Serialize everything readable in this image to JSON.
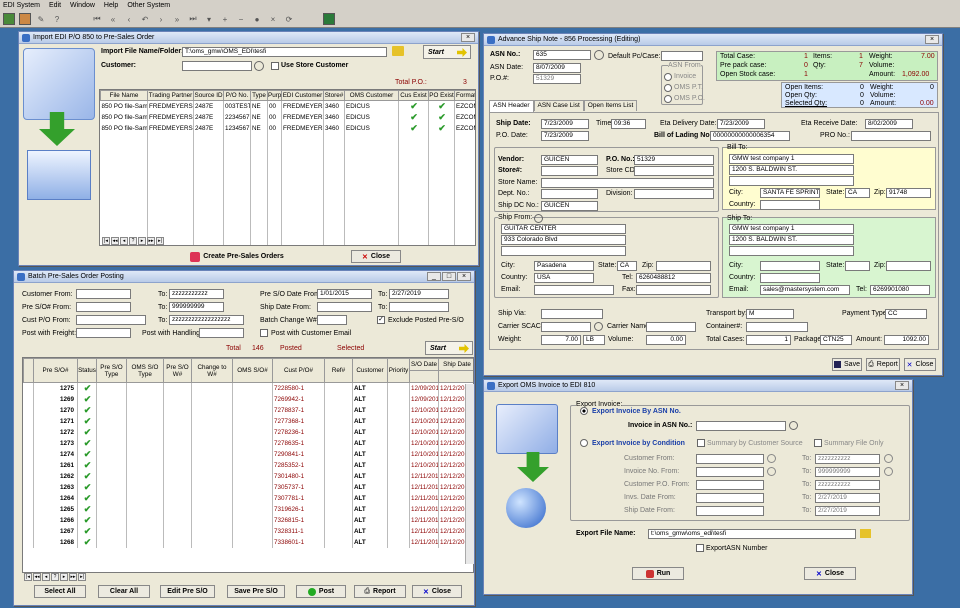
{
  "menu": [
    "EDI System",
    "Edit",
    "Window",
    "Help",
    "Other System"
  ],
  "import": {
    "title": "Import EDI P/O 850 to Pre-Sales Order",
    "folder_label": "Import File Name/Folder:",
    "folder_value": "T:\\oms_gmw\\OMS_EDI\\tesfi",
    "customer_label": "Customer:",
    "use_store": "Use Store Customer",
    "start": "Start",
    "total_label": "Total P.O.:",
    "total_value": "3",
    "columns": [
      "File Name",
      "Trading Partner",
      "Source ID",
      "P/O No.",
      "Type",
      "Purpo",
      "EDI Customer",
      "Store#",
      "OMS Customer",
      "Cus Exist",
      "PO Exist",
      "Format"
    ],
    "rows": [
      [
        "850 PO file-Samp",
        "FREDMEYERS",
        "2487E",
        "003TEST",
        "NE",
        "00",
        "FREDMEYERS",
        "3460",
        "EDICUS",
        "✔",
        "✔",
        "EZCOM"
      ],
      [
        "850 PO file-Samp",
        "FREDMEYERS",
        "2487E",
        "2234567",
        "NE",
        "00",
        "FREDMEYERS",
        "3460",
        "EDICUS",
        "✔",
        "✔",
        "EZCOM"
      ],
      [
        "850 PO file-Samp",
        "FREDMEYERS",
        "2487E",
        "1234567",
        "NE",
        "00",
        "FREDMEYERS",
        "3460",
        "EDICUS",
        "✔",
        "✔",
        "EZCOM"
      ]
    ],
    "create": "Create Pre-Sales Orders",
    "close": "Close"
  },
  "batch": {
    "title": "Batch Pre-Sales Order Posting",
    "customer_from": "Customer From:",
    "to": "To:",
    "customer_to": "zzzzzzzzzzz",
    "pre_so_from": "Pre S/O# From:",
    "pre_so_to": "999999999",
    "cust_po_from": "Cust P/O From:",
    "cust_po_to": "zzzzzzzzzzzzzzzzzz",
    "freight": "Post with Freight:",
    "handling": "Post with Handling:",
    "so_date_from": "Pre S/O Date From:",
    "so_date_from_val": "1/01/2015",
    "so_date_to_val": "2/27/2019",
    "ship_date_from": "Ship Date From:",
    "batch_change": "Batch Change W#:",
    "exclude": "Exclude Posted Pre-S/O",
    "post_email": "Post with Customer Email",
    "total": "Total",
    "total_val": "146",
    "posted": "Posted",
    "selected": "Selected",
    "start": "Start",
    "columns": [
      "Pre S/O#",
      "Status",
      "Pre S/O Type",
      "OMS S/O Type",
      "Pre S/O W#",
      "Change to W#",
      "OMS S/O#",
      "Cust P/O#",
      "Ref#",
      "Customer",
      "Priority",
      "S/O Date",
      "Ship Date"
    ],
    "rows": [
      [
        "1275",
        "7228580-1",
        "ALT",
        "12/09/2016",
        "12/12/2016"
      ],
      [
        "1269",
        "7269942-1",
        "ALT",
        "12/09/2016",
        "12/12/2016"
      ],
      [
        "1270",
        "7278837-1",
        "ALT",
        "12/10/2016",
        "12/12/2016"
      ],
      [
        "1271",
        "7277368-1",
        "ALT",
        "12/10/2016",
        "12/12/2016"
      ],
      [
        "1272",
        "7278236-1",
        "ALT",
        "12/10/2016",
        "12/12/2016"
      ],
      [
        "1273",
        "7278635-1",
        "ALT",
        "12/10/2016",
        "12/12/2016"
      ],
      [
        "1274",
        "7290841-1",
        "ALT",
        "12/10/2016",
        "12/12/2016"
      ],
      [
        "1261",
        "7285352-1",
        "ALT",
        "12/10/2016",
        "12/12/2016"
      ],
      [
        "1262",
        "7301480-1",
        "ALT",
        "12/11/2016",
        "12/12/2016"
      ],
      [
        "1263",
        "7305737-1",
        "ALT",
        "12/11/2016",
        "12/12/2016"
      ],
      [
        "1264",
        "7307781-1",
        "ALT",
        "12/11/2016",
        "12/12/2016"
      ],
      [
        "1265",
        "7319626-1",
        "ALT",
        "12/11/2016",
        "12/12/2016"
      ],
      [
        "1266",
        "7326815-1",
        "ALT",
        "12/11/2016",
        "12/12/2016"
      ],
      [
        "1267",
        "7328311-1",
        "ALT",
        "12/11/2016",
        "12/12/2016"
      ],
      [
        "1268",
        "7338601-1",
        "ALT",
        "12/11/2016",
        "12/12/2016"
      ]
    ],
    "select_all": "Select All",
    "clear_all": "Clear All",
    "edit": "Edit Pre S/O",
    "save": "Save Pre S/O",
    "post": "Post",
    "report": "Report",
    "close": "Close"
  },
  "asn": {
    "title": "Advance Ship Note - 856 Processing (Editing)",
    "asn_no_l": "ASN No.:",
    "asn_no": "635",
    "asn_date_l": "ASN Date:",
    "asn_date": "8/07/2009",
    "po_l": "P.O.#:",
    "po": "51329",
    "default_pc": "Default Pc/Case:",
    "asn_from": "ASN From",
    "opt1": "Invoice",
    "opt2": "OMS P.T.",
    "opt3": "OMS P.O.",
    "sum": {
      "tc_l": "Total Case:",
      "tc": "1",
      "items_l": "Items:",
      "items": "1",
      "weight_l": "Weight:",
      "weight": "7.00",
      "ppc_l": "Pre pack case:",
      "ppc": "0",
      "qty_l": "Qty:",
      "qty": "7",
      "volume_l": "Volume:",
      "osc_l": "Open Stock case:",
      "osc": "1",
      "amount_l": "Amount:",
      "amount": "1,092.00",
      "oi_l": "Open Items:",
      "oi": "0",
      "w2_l": "Weight:",
      "w2": "0",
      "oq_l": "Open Qty:",
      "oq": "0",
      "v2_l": "Volume:",
      "sq_l": "Selected Qty:",
      "sq": "0",
      "a2_l": "Amount:",
      "a2": "0.00"
    },
    "tabs": [
      "ASN Header",
      "ASN Case List",
      "Open Items List"
    ],
    "ship_date_l": "Ship Date:",
    "ship_date": "7/23/2009",
    "time_l": "Time:",
    "time": "09:36",
    "eta_del_l": "Eta Delivery Date:",
    "eta_del": "7/23/2009",
    "eta_rec_l": "Eta Receive Date:",
    "eta_rec": "8/02/2009",
    "po_date_l": "P.O. Date:",
    "po_date": "7/23/2009",
    "bol_l": "Bill of Lading No.:",
    "bol": "00000000000006354",
    "pro_l": "PRO No.:",
    "vendor_l": "Vendor:",
    "vendor": "GUICEN",
    "pono_l": "P.O. No.:",
    "pono": "51329",
    "store_l": "Store#:",
    "storecd_l": "Store CD:",
    "storename_l": "Store Name:",
    "dept_l": "Dept. No.:",
    "div_l": "Division:",
    "shipdc_l": "Ship DC No.:",
    "shipdc": "GUICEN",
    "billto_l": "Bill To:",
    "billto1": "GMW test company 1",
    "billto2": "1200 S. BALDWIN ST.",
    "city_l": "City:",
    "bcity": "SANTA FE SPRINTS",
    "state_l": "State:",
    "bstate": "CA",
    "zip_l": "Zip:",
    "bzip": "91748",
    "country_l": "Country:",
    "shipfrom_l": "Ship From:",
    "sf1": "GUITAR CENTER",
    "sf2": "933 Colorado Blvd",
    "sfcity": "Pasadena",
    "sfstate": "CA",
    "sfcountry": "USA",
    "tel_l": "Tel:",
    "sftel": "6260488812",
    "email_l": "Email:",
    "fax_l": "Fax:",
    "shipto_l": "Ship To:",
    "st1": "GMW test company 1",
    "st2": "1200 S. BALDWIN ST.",
    "stemail": "sales@mastersystem.com",
    "sttel": "6269901080",
    "shipvia_l": "Ship Via:",
    "transport_l": "Transport by:",
    "transport": "M",
    "paytype_l": "Payment Type:",
    "paytype": "CC",
    "scac_l": "Carrier SCAC:",
    "carriername_l": "Carrier Name:",
    "container_l": "Container#:",
    "weight_l": "Weight:",
    "weight": "7.00",
    "weight_u": "LB",
    "volume_l": "Volume:",
    "volume": "0.00",
    "totcases_l": "Total Cases:",
    "totcases": "1",
    "package_l": "Package:",
    "package": "CTN25",
    "amount_l": "Amount:",
    "amount": "1092.00",
    "save": "Save",
    "report": "Report",
    "close": "Close"
  },
  "export": {
    "title": "Export OMS Invoice to EDI 810",
    "export_inv": "Export Invoice:",
    "by_asn": "Export Invoice By ASN No.",
    "inv_asn_l": "Invoice in ASN No.:",
    "by_cond": "Export Invoice by Condition",
    "sum_cust": "Summary by Customer Source",
    "sum_file": "Summary File Only",
    "cust_from": "Customer From:",
    "inv_from": "Invoice No. From:",
    "custpo_from": "Customer P.O. From:",
    "invdate_from": "Invs. Date From:",
    "shipdate_from": "Ship Date From:",
    "to": "To:",
    "cust_to": "zzzzzzzzzz",
    "inv_to": "999999999",
    "custpo_to": "zzzzzzzzzz",
    "invdate_to": "2/27/2019",
    "shipdate_to": "2/27/2019",
    "file_l": "Export File Name:",
    "file": "t:\\oms_gmw\\oms_edi\\tesfi",
    "export_asn": "ExportASN Number",
    "run": "Run",
    "close": "Close"
  }
}
